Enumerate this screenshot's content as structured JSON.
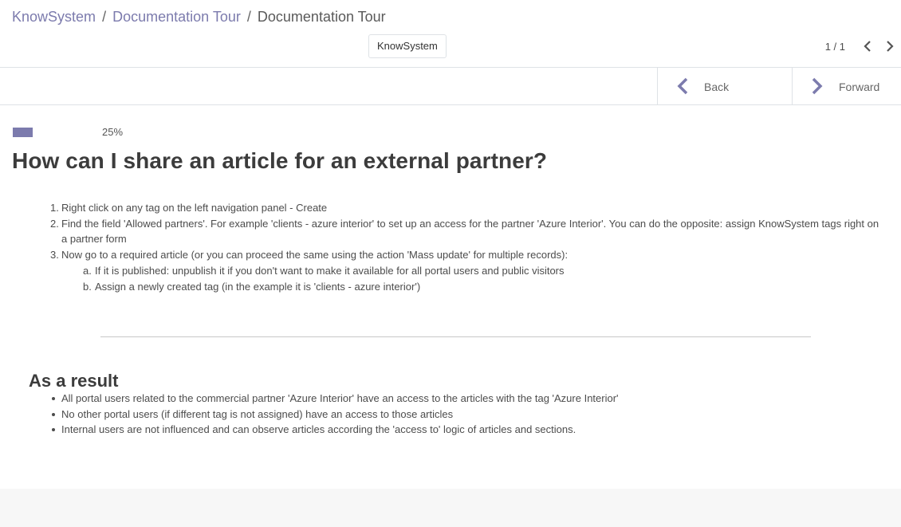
{
  "breadcrumb": {
    "items": [
      "KnowSystem",
      "Documentation Tour"
    ],
    "separator": "/",
    "current": "Documentation Tour"
  },
  "tag_button": {
    "label": "KnowSystem"
  },
  "pager": {
    "value": "1 / 1"
  },
  "navigation": {
    "back_label": "Back",
    "forward_label": "Forward"
  },
  "progress": {
    "percent": 25,
    "label": "25%"
  },
  "article": {
    "title": "How can I share an article for an external partner?",
    "steps": [
      {
        "num": "1.",
        "text": "Right click on any tag on the left navigation panel - Create"
      },
      {
        "num": "2.",
        "text": "Find the field 'Allowed partners'. For example 'clients - azure interior' to set up an access for the partner 'Azure Interior'. You can do the opposite: assign KnowSystem tags right on a partner form"
      },
      {
        "num": "3.",
        "text": "Now go to a required article (or you can proceed the same using the action 'Mass update' for multiple records):"
      }
    ],
    "substeps": [
      {
        "num": "a.",
        "text": "If it is published: unpublish it if you don't want to make it available for all portal users and public visitors"
      },
      {
        "num": "b.",
        "text": "Assign a newly created tag (in the example it is 'clients - azure interior')"
      }
    ],
    "result_heading": "As a result",
    "results": [
      "All portal users related to the commercial partner 'Azure Interior' have an access to the articles with the tag 'Azure Interior'",
      "No other portal users (if different tag is not assigned) have an access to those articles",
      "Internal users are not influenced and can observe articles according the 'access to' logic of articles and sections."
    ]
  },
  "colors": {
    "accent": "#7c7bad",
    "text": "#4c4c4c",
    "border": "#dee2e6"
  }
}
